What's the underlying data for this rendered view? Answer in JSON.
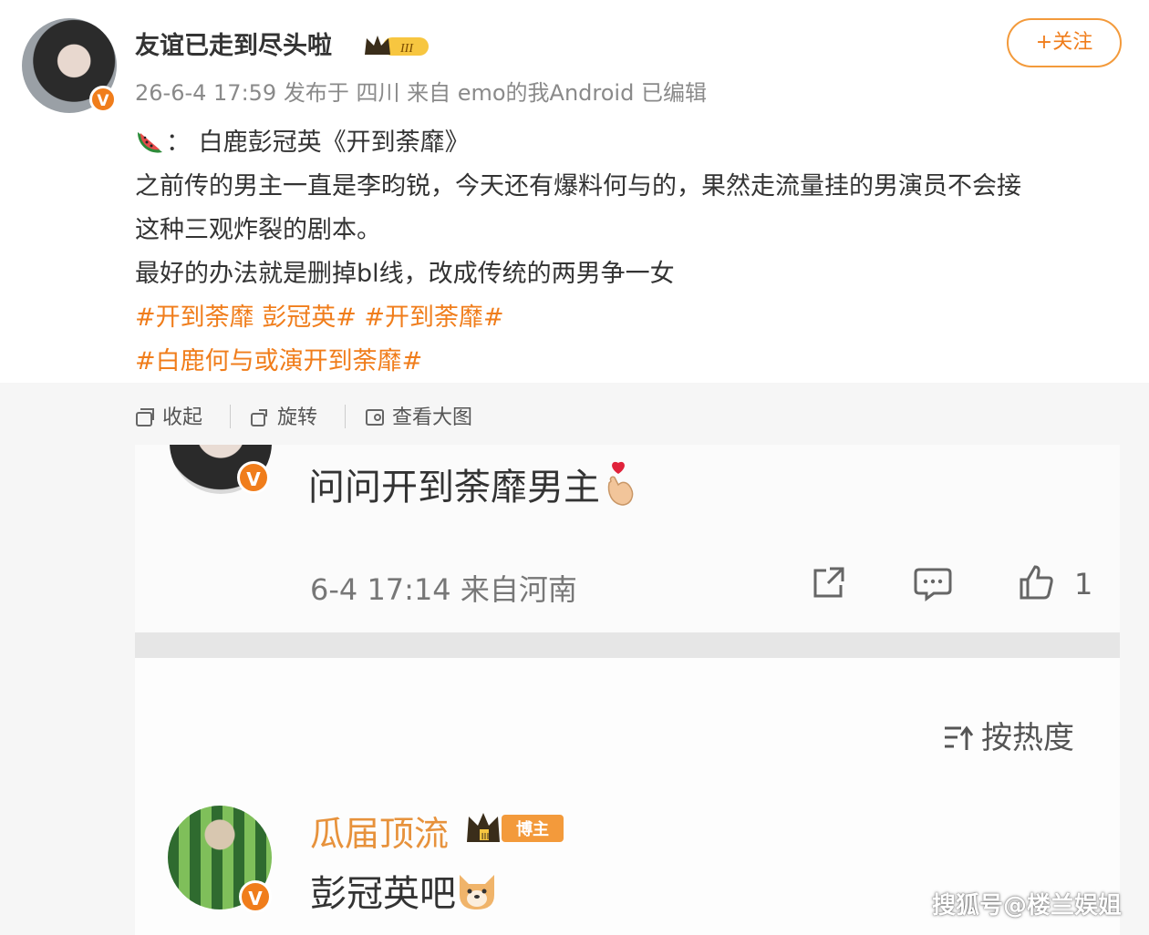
{
  "post": {
    "username": "友谊已走到尽头啦",
    "level_badge": "III",
    "meta": "26-6-4 17:59 发布于 四川 来自 emo的我Android 已编辑",
    "follow_label": "+关注",
    "line1_suffix": "：  白鹿彭冠英《开到荼靡》",
    "line2": "之前传的男主一直是李昀锐，今天还有爆料何与的，果然走流量挂的男演员不会接",
    "line3": "这种三观炸裂的剧本。",
    "line4": "最好的办法就是删掉bl线，改成传统的两男争一女",
    "topics1": "#开到荼靡 彭冠英# #开到荼靡#",
    "topics2": "#白鹿何与或演开到荼靡#"
  },
  "toolbar": {
    "collapse": "收起",
    "rotate": "旋转",
    "view_large": "查看大图"
  },
  "reply": {
    "text": "问问开到荼靡男主",
    "meta": "6-4 17:14  来自河南",
    "like_count": "1"
  },
  "comments": {
    "sort_label": "按热度",
    "user": "瓜届顶流",
    "badge": "博主",
    "badge_level": "III",
    "text": "彭冠英吧"
  },
  "watermark": "搜狐号@楼兰娱姐",
  "colors": {
    "accent": "#f07d1b",
    "topic": "#f07d1b",
    "text": "#333333",
    "muted": "#8a8a8a"
  }
}
